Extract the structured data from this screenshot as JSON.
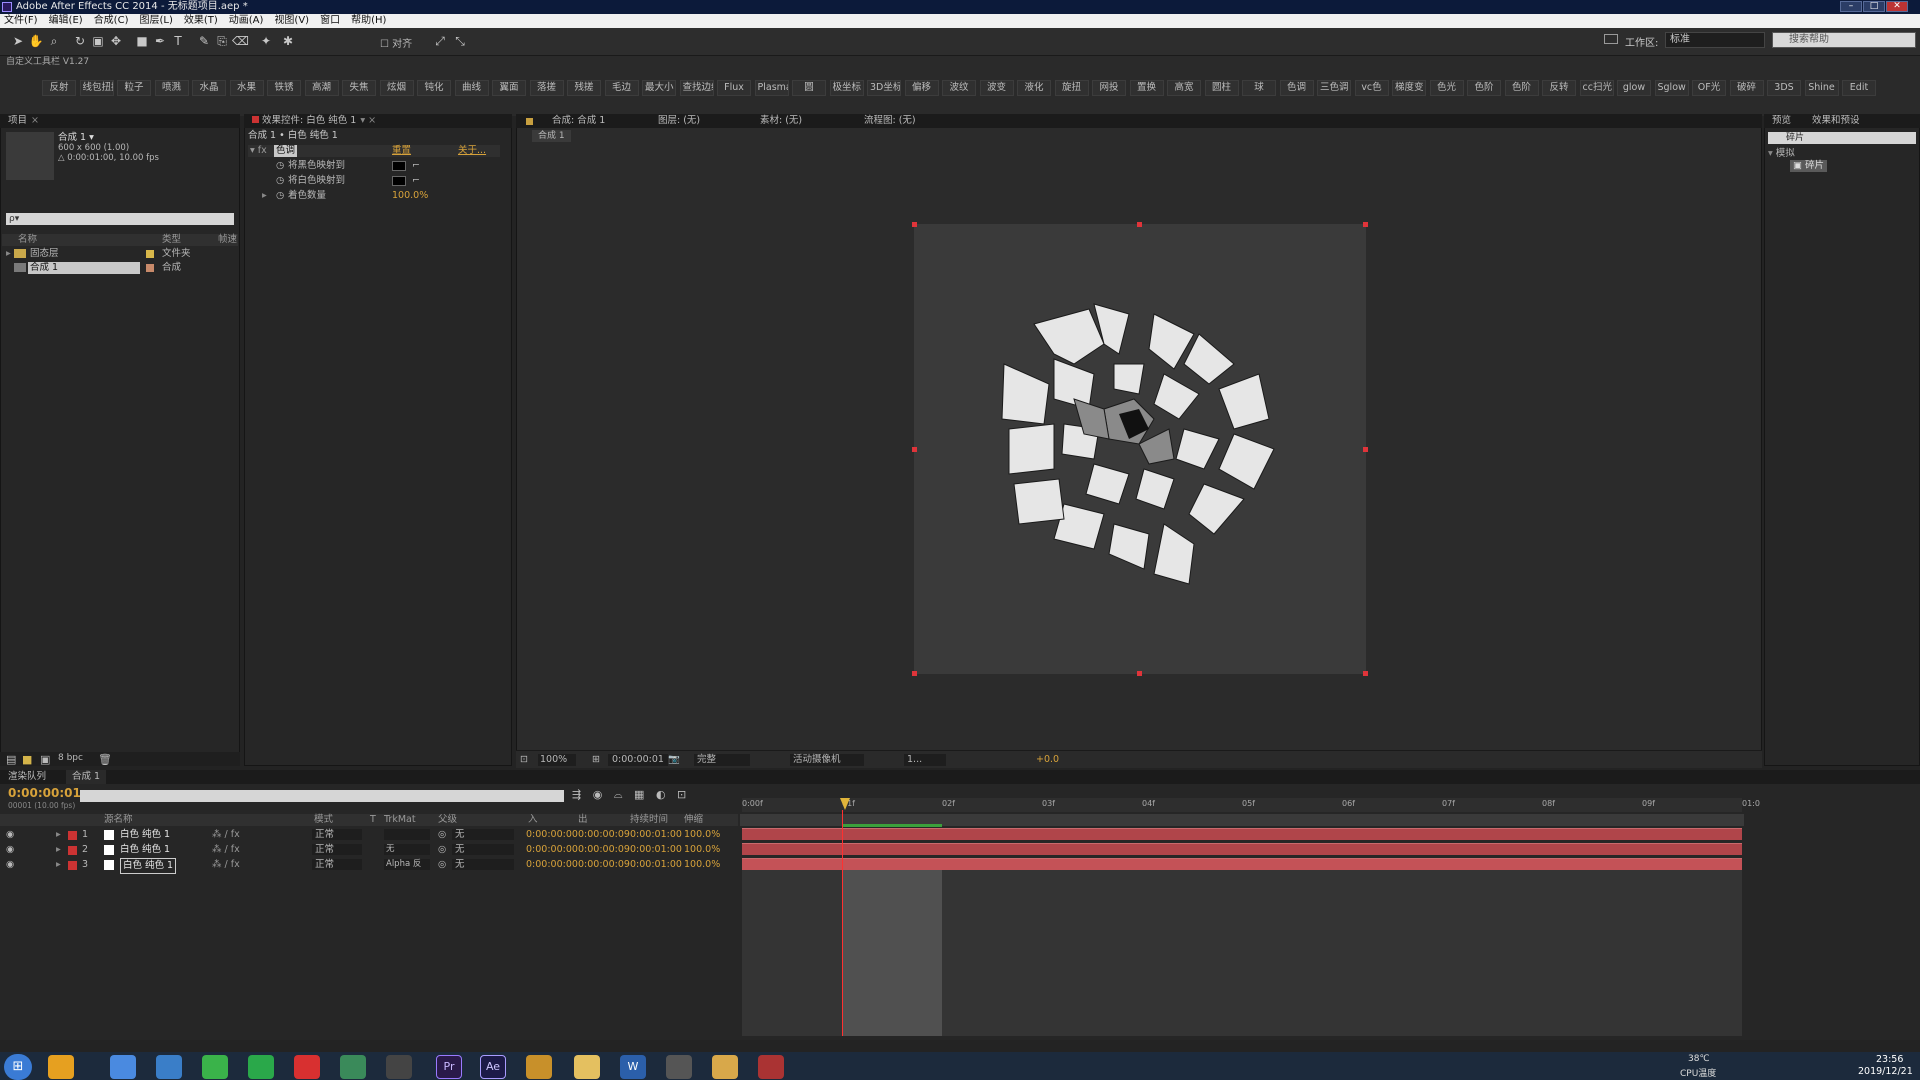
{
  "app": {
    "title": "Adobe After Effects CC 2014 - 无标题项目.aep *"
  },
  "menu": [
    "文件(F)",
    "编辑(E)",
    "合成(C)",
    "图层(L)",
    "效果(T)",
    "动画(A)",
    "视图(V)",
    "窗口",
    "帮助(H)"
  ],
  "toolbar": {
    "align_label": "对齐",
    "workspace_label": "工作区:",
    "workspace_value": "标准",
    "help_placeholder": "搜索帮助"
  },
  "custom_toolbar": {
    "title": "自定义工具栏 V1.27",
    "buttons": [
      "反射",
      "线包扭摆",
      "粒子",
      "喷溅",
      "水晶",
      "水果",
      "铁锈",
      "高潮",
      "失焦",
      "炫烟",
      "钝化",
      "曲线",
      "翼面",
      "落搓",
      "残搓",
      "毛边",
      "最大小",
      "查找边缘",
      "Flux",
      "Plasma",
      "圆",
      "极坐标",
      "3D坐标",
      "偏移",
      "波纹",
      "波变",
      "液化",
      "旋扭",
      "网投",
      "置换",
      "高宽",
      "圆柱",
      "球",
      "色调",
      "三色调",
      "vc色",
      "梯度变",
      "色光",
      "色阶",
      "色阶",
      "反转",
      "cc扫光",
      "glow",
      "Sglow",
      "OF光",
      "破碎",
      "3DS",
      "Shine",
      "Edit"
    ]
  },
  "project_panel": {
    "tab": "项目",
    "comp_name": "合成 1 ▾",
    "comp_size": "600 x 600 (1.00)",
    "comp_duration": "△ 0:00:01:00, 10.00 fps",
    "search_placeholder": "ρ▾",
    "columns": [
      "名称",
      "类型",
      "帧速"
    ],
    "items": [
      {
        "name": "固态层",
        "type": "文件夹"
      },
      {
        "name": "合成 1",
        "type": "合成"
      }
    ],
    "bpc": "8 bpc"
  },
  "effects_panel": {
    "tab": "效果控件: 白色 纯色 1",
    "breadcrumb": "合成 1 • 白色 纯色 1",
    "effect_name": "色调",
    "reset": "重置",
    "about": "关于...",
    "props": [
      {
        "label": "将黑色映射到"
      },
      {
        "label": "将白色映射到"
      },
      {
        "label": "着色数量",
        "value": "100.0%"
      }
    ]
  },
  "viewer": {
    "tab": "合成: 合成 1",
    "layer_tab": "图层: (无)",
    "footage_tab": "素材: (无)",
    "flow_tab": "流程图: (无)",
    "comp_tab": "合成 1",
    "zoom": "100%",
    "timecode": "0:00:00:01",
    "resolution": "完整",
    "camera": "活动摄像机",
    "views": "1...",
    "exposure": "+0.0"
  },
  "right_panel": {
    "tabs": [
      "预览",
      "效果和预设"
    ],
    "search": "碎片",
    "category": "模拟",
    "result": "碎片"
  },
  "timeline": {
    "tabs": [
      "渲染队列",
      "合成 1"
    ],
    "timecode": "0:00:00:01",
    "frame_info": "00001 (10.00 fps)",
    "columns": [
      "源名称",
      "模式",
      "T",
      "TrkMat",
      "父级",
      "入",
      "出",
      "持续时间",
      "伸缩"
    ],
    "layers": [
      {
        "num": "1",
        "name": "白色 纯色 1",
        "mode": "正常",
        "trkmat": "",
        "parent": "无",
        "in": "0:00:00:00",
        "out": "0:00:00:09",
        "dur": "0:00:01:00",
        "stretch": "100.0%"
      },
      {
        "num": "2",
        "name": "白色 纯色 1",
        "mode": "正常",
        "trkmat": "无",
        "parent": "无",
        "in": "0:00:00:00",
        "out": "0:00:00:09",
        "dur": "0:00:01:00",
        "stretch": "100.0%"
      },
      {
        "num": "3",
        "name": "白色 纯色 1",
        "mode": "正常",
        "trkmat": "Alpha 反",
        "parent": "无",
        "in": "0:00:00:00",
        "out": "0:00:00:09",
        "dur": "0:00:01:00",
        "stretch": "100.0%"
      }
    ],
    "ruler": [
      "0:00f",
      "01f",
      "02f",
      "03f",
      "04f",
      "05f",
      "06f",
      "07f",
      "08f",
      "09f",
      "01:0"
    ]
  },
  "tray": {
    "temp": "38℃",
    "cpu": "CPU温度",
    "time": "23:56",
    "date": "2019/12/21"
  },
  "colors": {
    "accent_orange": "#d7a23a",
    "bar_red": "#b0454a",
    "playhead": "#ff3030"
  }
}
